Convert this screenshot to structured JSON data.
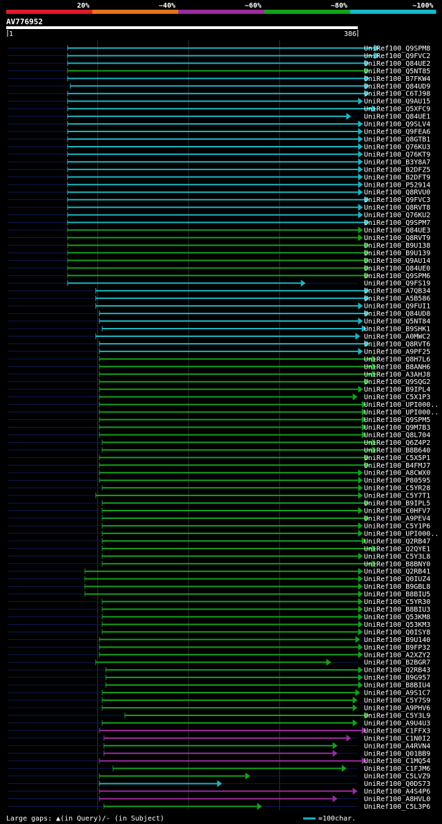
{
  "chart_data": {
    "type": "bar",
    "title": "AV776952",
    "identity_legend": [
      {
        "label": "20%",
        "color": "#e0192c"
      },
      {
        "label": "~40%",
        "color": "#e5731a"
      },
      {
        "label": "~60%",
        "color": "#9b2d9e"
      },
      {
        "label": "~80%",
        "color": "#12a31a"
      },
      {
        "label": "~100%",
        "color": "#18b8c6"
      }
    ],
    "query_range": [
      1,
      386
    ],
    "ruler_start_label": "1",
    "ruler_end_label": "386",
    "scale_label": "=100char.",
    "gaps_label": "Large gaps: ▲(in Query)/- (in Subject)",
    "hits": [
      {
        "name": "UniRef100_Q9SPM8",
        "start": 67,
        "end": 409,
        "color": "#18b8c6"
      },
      {
        "name": "UniRef100_Q9FVC2",
        "start": 67,
        "end": 409,
        "color": "#18b8c6"
      },
      {
        "name": "UniRef100_Q84UE2",
        "start": 67,
        "end": 398,
        "color": "#18b8c6"
      },
      {
        "name": "UniRef100_Q5NT85",
        "start": 67,
        "end": 398,
        "color": "#12a31a"
      },
      {
        "name": "UniRef100_B7FKW4",
        "start": 67,
        "end": 398,
        "color": "#18b8c6"
      },
      {
        "name": "UniRef100_Q84UD9",
        "start": 70,
        "end": 398,
        "color": "#18b8c6"
      },
      {
        "name": "UniRef100_C6TJ98",
        "start": 67,
        "end": 398,
        "color": "#18b8c6"
      },
      {
        "name": "UniRef100_Q9AU15",
        "start": 67,
        "end": 391,
        "color": "#18b8c6"
      },
      {
        "name": "UniRef100_Q5XFC9",
        "start": 67,
        "end": 406,
        "color": "#18b8c6"
      },
      {
        "name": "UniRef100_Q84UE1",
        "start": 67,
        "end": 378,
        "color": "#18b8c6"
      },
      {
        "name": "UniRef100_Q9SLV4",
        "start": 67,
        "end": 391,
        "color": "#18b8c6"
      },
      {
        "name": "UniRef100_Q9FEA6",
        "start": 67,
        "end": 391,
        "color": "#18b8c6"
      },
      {
        "name": "UniRef100_Q8GTB1",
        "start": 67,
        "end": 391,
        "color": "#18b8c6"
      },
      {
        "name": "UniRef100_Q76KU3",
        "start": 67,
        "end": 391,
        "color": "#18b8c6"
      },
      {
        "name": "UniRef100_Q76KT9",
        "start": 67,
        "end": 391,
        "color": "#18b8c6"
      },
      {
        "name": "UniRef100_B3Y8A7",
        "start": 67,
        "end": 391,
        "color": "#18b8c6"
      },
      {
        "name": "UniRef100_B2DFZ5",
        "start": 67,
        "end": 391,
        "color": "#18b8c6"
      },
      {
        "name": "UniRef100_B2DFT9",
        "start": 67,
        "end": 391,
        "color": "#18b8c6"
      },
      {
        "name": "UniRef100_P52914",
        "start": 67,
        "end": 391,
        "color": "#18b8c6"
      },
      {
        "name": "UniRef100_Q8RVU0",
        "start": 67,
        "end": 391,
        "color": "#18b8c6"
      },
      {
        "name": "UniRef100_Q9FVC3",
        "start": 67,
        "end": 398,
        "color": "#18b8c6"
      },
      {
        "name": "UniRef100_Q8RVT8",
        "start": 67,
        "end": 391,
        "color": "#18b8c6"
      },
      {
        "name": "UniRef100_Q76KU2",
        "start": 67,
        "end": 391,
        "color": "#18b8c6"
      },
      {
        "name": "UniRef100_Q9SPM7",
        "start": 67,
        "end": 398,
        "color": "#18b8c6"
      },
      {
        "name": "UniRef100_Q84UE3",
        "start": 67,
        "end": 391,
        "color": "#12a31a"
      },
      {
        "name": "UniRef100_Q8RVT9",
        "start": 67,
        "end": 391,
        "color": "#12a31a"
      },
      {
        "name": "UniRef100_B9U138",
        "start": 67,
        "end": 398,
        "color": "#12a31a"
      },
      {
        "name": "UniRef100_B9U139",
        "start": 67,
        "end": 398,
        "color": "#12a31a"
      },
      {
        "name": "UniRef100_Q9AU14",
        "start": 67,
        "end": 398,
        "color": "#12a31a"
      },
      {
        "name": "UniRef100_Q84UE0",
        "start": 67,
        "end": 398,
        "color": "#12a31a"
      },
      {
        "name": "UniRef100_Q9SPM6",
        "start": 67,
        "end": 398,
        "color": "#12a31a"
      },
      {
        "name": "UniRef100_Q9FS19",
        "start": 67,
        "end": 328,
        "color": "#18b8c6"
      },
      {
        "name": "UniRef100_A7QB34",
        "start": 98,
        "end": 398,
        "color": "#18b8c6"
      },
      {
        "name": "UniRef100_A5B586",
        "start": 98,
        "end": 398,
        "color": "#18b8c6"
      },
      {
        "name": "UniRef100_Q9FUI1",
        "start": 98,
        "end": 391,
        "color": "#18b8c6"
      },
      {
        "name": "UniRef100_Q84UD8",
        "start": 102,
        "end": 398,
        "color": "#18b8c6"
      },
      {
        "name": "UniRef100_Q5NT84",
        "start": 102,
        "end": 391,
        "color": "#18b8c6"
      },
      {
        "name": "UniRef100_B9SHK1",
        "start": 105,
        "end": 395,
        "color": "#18b8c6"
      },
      {
        "name": "UniRef100_A0MWC2",
        "start": 98,
        "end": 388,
        "color": "#18b8c6"
      },
      {
        "name": "UniRef100_Q8RVT6",
        "start": 102,
        "end": 398,
        "color": "#18b8c6"
      },
      {
        "name": "UniRef100_A9PF25",
        "start": 102,
        "end": 391,
        "color": "#18b8c6"
      },
      {
        "name": "UniRef100_Q8H7L6",
        "start": 102,
        "end": 406,
        "color": "#12a31a"
      },
      {
        "name": "UniRef100_B8ANH6",
        "start": 102,
        "end": 406,
        "color": "#12a31a"
      },
      {
        "name": "UniRef100_A3AHJ8",
        "start": 102,
        "end": 406,
        "color": "#12a31a"
      },
      {
        "name": "UniRef100_Q9SQG2",
        "start": 102,
        "end": 398,
        "color": "#12a31a"
      },
      {
        "name": "UniRef100_B9IPL4",
        "start": 102,
        "end": 391,
        "color": "#12a31a"
      },
      {
        "name": "UniRef100_C5X1P3",
        "start": 102,
        "end": 385,
        "color": "#12a31a"
      },
      {
        "name": "UniRef100_UPI000..",
        "start": 102,
        "end": 395,
        "color": "#12a31a"
      },
      {
        "name": "UniRef100_UPI000..",
        "start": 102,
        "end": 395,
        "color": "#12a31a"
      },
      {
        "name": "UniRef100_Q9SPM5",
        "start": 102,
        "end": 395,
        "color": "#12a31a"
      },
      {
        "name": "UniRef100_Q9M7B3",
        "start": 102,
        "end": 395,
        "color": "#12a31a"
      },
      {
        "name": "UniRef100_Q8L704",
        "start": 102,
        "end": 395,
        "color": "#12a31a"
      },
      {
        "name": "UniRef100_Q6Z4P2",
        "start": 105,
        "end": 406,
        "color": "#12a31a"
      },
      {
        "name": "UniRef100_B8B640",
        "start": 105,
        "end": 406,
        "color": "#12a31a"
      },
      {
        "name": "UniRef100_C5X5P1",
        "start": 102,
        "end": 398,
        "color": "#12a31a"
      },
      {
        "name": "UniRef100_B4FMJ7",
        "start": 102,
        "end": 398,
        "color": "#12a31a"
      },
      {
        "name": "UniRef100_A8CWX0",
        "start": 102,
        "end": 391,
        "color": "#12a31a"
      },
      {
        "name": "UniRef100_P80595",
        "start": 102,
        "end": 391,
        "color": "#12a31a"
      },
      {
        "name": "UniRef100_C5YR28",
        "start": 105,
        "end": 391,
        "color": "#12a31a"
      },
      {
        "name": "UniRef100_C5Y7T1",
        "start": 98,
        "end": 391,
        "color": "#12a31a"
      },
      {
        "name": "UniRef100_B9IPL5",
        "start": 105,
        "end": 398,
        "color": "#12a31a"
      },
      {
        "name": "UniRef100_C0HFV7",
        "start": 105,
        "end": 391,
        "color": "#12a31a"
      },
      {
        "name": "UniRef100_A9PEV4",
        "start": 105,
        "end": 398,
        "color": "#12a31a"
      },
      {
        "name": "UniRef100_C5Y1P6",
        "start": 105,
        "end": 391,
        "color": "#12a31a"
      },
      {
        "name": "UniRef100_UPI000..",
        "start": 105,
        "end": 391,
        "color": "#12a31a"
      },
      {
        "name": "UniRef100_Q2RB47",
        "start": 105,
        "end": 395,
        "color": "#12a31a"
      },
      {
        "name": "UniRef100_Q2QYE1",
        "start": 105,
        "end": 406,
        "color": "#12a31a"
      },
      {
        "name": "UniRef100_C5Y3L8",
        "start": 105,
        "end": 391,
        "color": "#12a31a"
      },
      {
        "name": "UniRef100_B8BNY0",
        "start": 105,
        "end": 406,
        "color": "#12a31a"
      },
      {
        "name": "UniRef100_Q2RB41",
        "start": 86,
        "end": 391,
        "color": "#12a31a"
      },
      {
        "name": "UniRef100_Q0IUZ4",
        "start": 86,
        "end": 391,
        "color": "#12a31a"
      },
      {
        "name": "UniRef100_B9GBL8",
        "start": 86,
        "end": 391,
        "color": "#12a31a"
      },
      {
        "name": "UniRef100_B8BIU5",
        "start": 86,
        "end": 391,
        "color": "#12a31a"
      },
      {
        "name": "UniRef100_C5YR30",
        "start": 105,
        "end": 391,
        "color": "#12a31a"
      },
      {
        "name": "UniRef100_B8BIU3",
        "start": 105,
        "end": 391,
        "color": "#12a31a"
      },
      {
        "name": "UniRef100_Q53KM8",
        "start": 105,
        "end": 391,
        "color": "#12a31a"
      },
      {
        "name": "UniRef100_Q53KM3",
        "start": 105,
        "end": 391,
        "color": "#12a31a"
      },
      {
        "name": "UniRef100_Q0ISY8",
        "start": 105,
        "end": 391,
        "color": "#12a31a"
      },
      {
        "name": "UniRef100_B9U140",
        "start": 102,
        "end": 388,
        "color": "#12a31a"
      },
      {
        "name": "UniRef100_B9FP32",
        "start": 102,
        "end": 391,
        "color": "#12a31a"
      },
      {
        "name": "UniRef100_A2XZY2",
        "start": 102,
        "end": 391,
        "color": "#12a31a"
      },
      {
        "name": "UniRef100_B2BGR7",
        "start": 98,
        "end": 356,
        "color": "#12a31a"
      },
      {
        "name": "UniRef100_Q2RB43",
        "start": 109,
        "end": 391,
        "color": "#12a31a"
      },
      {
        "name": "UniRef100_B9G957",
        "start": 109,
        "end": 391,
        "color": "#12a31a"
      },
      {
        "name": "UniRef100_B8BIU4",
        "start": 109,
        "end": 391,
        "color": "#12a31a"
      },
      {
        "name": "UniRef100_A9S1C7",
        "start": 105,
        "end": 388,
        "color": "#12a31a"
      },
      {
        "name": "UniRef100_C5Y7S9",
        "start": 105,
        "end": 385,
        "color": "#12a31a"
      },
      {
        "name": "UniRef100_A9PHV6",
        "start": 105,
        "end": 385,
        "color": "#12a31a"
      },
      {
        "name": "UniRef100_C5Y3L9",
        "start": 130,
        "end": 398,
        "color": "#12a31a"
      },
      {
        "name": "UniRef100_A9U4U3",
        "start": 105,
        "end": 385,
        "color": "#12a31a"
      },
      {
        "name": "UniRef100_C1FFX3",
        "start": 102,
        "end": 395,
        "color": "#9b2d9e"
      },
      {
        "name": "UniRef100_C1N0I2",
        "start": 107,
        "end": 378,
        "color": "#9b2d9e"
      },
      {
        "name": "UniRef100_A4RVN4",
        "start": 107,
        "end": 363,
        "color": "#12a31a"
      },
      {
        "name": "UniRef100_Q01BB9",
        "start": 107,
        "end": 363,
        "color": "#9b2d9e"
      },
      {
        "name": "UniRef100_C1MQ54",
        "start": 102,
        "end": 395,
        "color": "#9b2d9e"
      },
      {
        "name": "UniRef100_C1FJM6",
        "start": 117,
        "end": 373,
        "color": "#12a31a"
      },
      {
        "name": "UniRef100_C5LVZ9",
        "start": 102,
        "end": 267,
        "color": "#12a31a"
      },
      {
        "name": "UniRef100_Q0DS73",
        "start": 102,
        "end": 236,
        "color": "#18b8c6"
      },
      {
        "name": "UniRef100_A4S4P6",
        "start": 102,
        "end": 385,
        "color": "#9b2d9e"
      },
      {
        "name": "UniRef100_A8HVL0",
        "start": 102,
        "end": 363,
        "color": "#9b2d9e"
      },
      {
        "name": "UniRef100_C5L3P6",
        "start": 107,
        "end": 280,
        "color": "#12a31a"
      }
    ]
  }
}
